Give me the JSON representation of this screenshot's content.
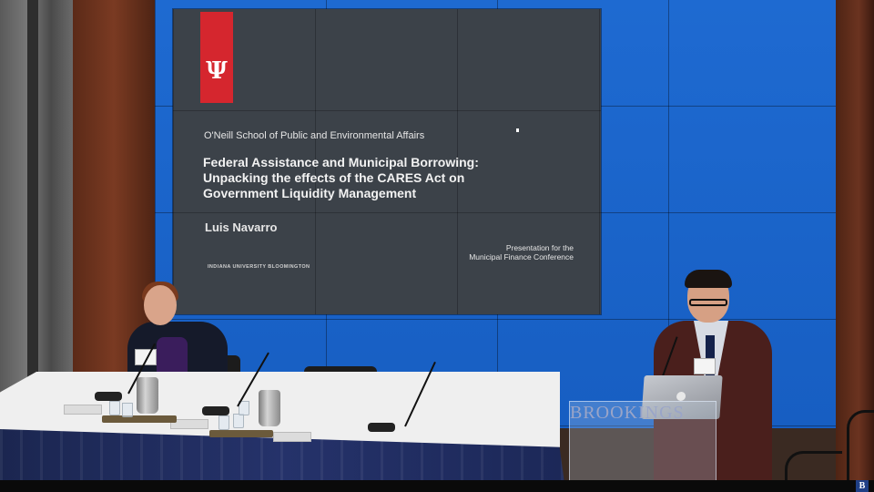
{
  "slide": {
    "logo_glyph": "Ψ",
    "school": "O'Neill School of Public and Environmental Affairs",
    "title": "Federal Assistance and Municipal Borrowing: Unpacking the effects of the CARES Act on Government Liquidity Management",
    "author": "Luis Navarro",
    "university": "INDIANA UNIVERSITY BLOOMINGTON",
    "presentation_line1": "Presentation for the",
    "presentation_line2": "Municipal Finance Conference"
  },
  "podium": {
    "sign": "BROOKINGS"
  },
  "corner_logo": "B",
  "colors": {
    "videowall_blue": "#1a64c8",
    "slide_bg": "#3c4249",
    "iu_red": "#d5262e",
    "table_skirt": "#25326a"
  }
}
